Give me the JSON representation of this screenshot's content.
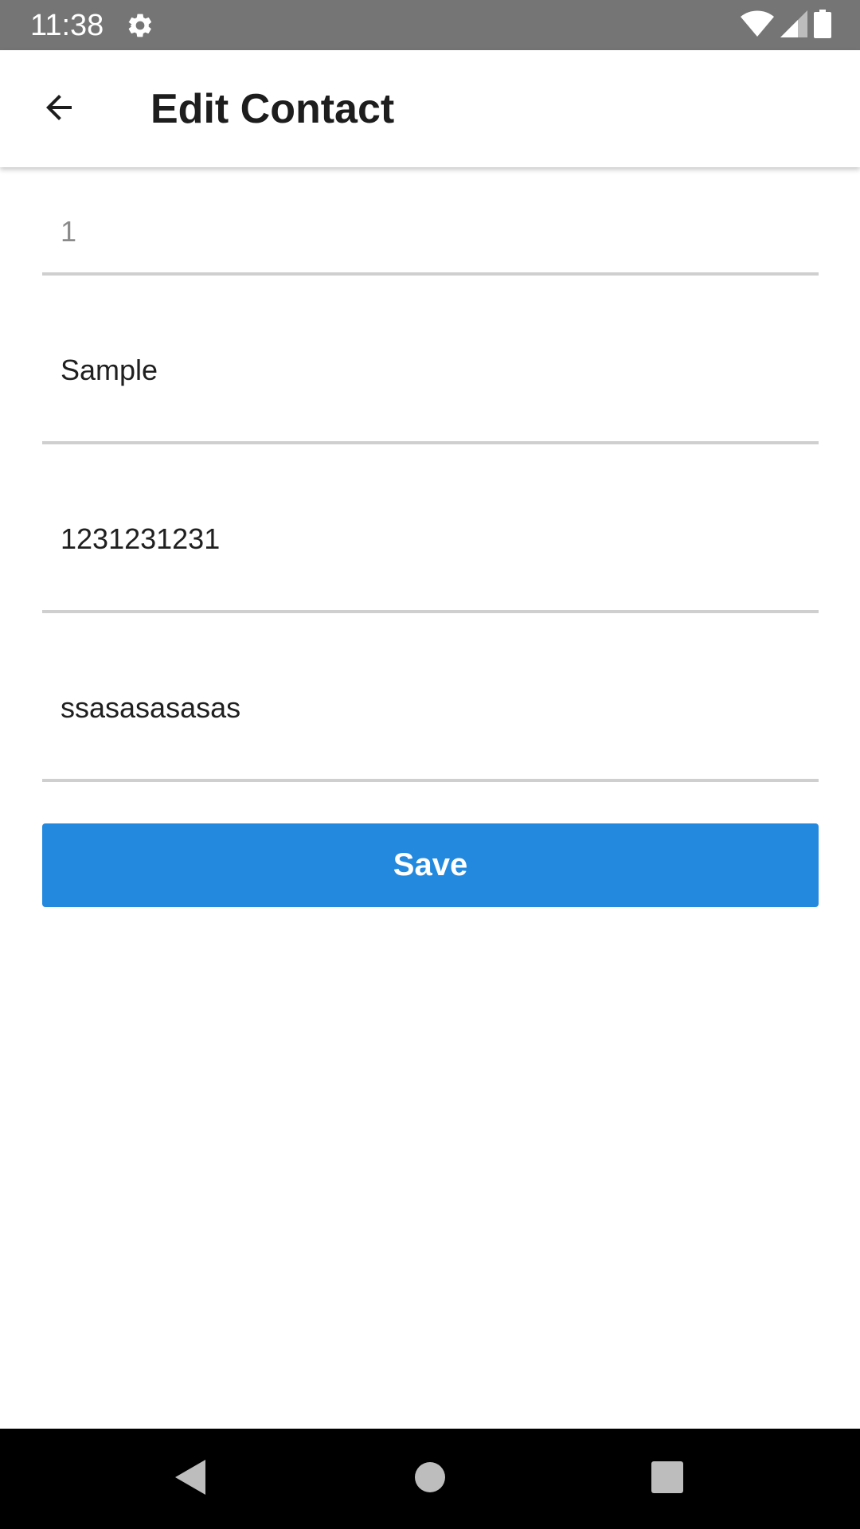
{
  "status_bar": {
    "time": "11:38",
    "icons": [
      "settings-gear-icon",
      "wifi-icon",
      "cell-signal-icon",
      "battery-icon"
    ]
  },
  "app_bar": {
    "back_icon": "arrow-back-icon",
    "title": "Edit Contact"
  },
  "form": {
    "id_value": "1",
    "name_value": "Sample",
    "phone_value": "1231231231",
    "email_value": "ssasasasasas",
    "save_label": "Save"
  },
  "nav_bar": {
    "icons": [
      "nav-back-icon",
      "nav-home-icon",
      "nav-recents-icon"
    ]
  },
  "colors": {
    "status_bar": "#757575",
    "accent": "#2389de",
    "underline": "#cfcfcf",
    "nav_bar": "#000000"
  }
}
